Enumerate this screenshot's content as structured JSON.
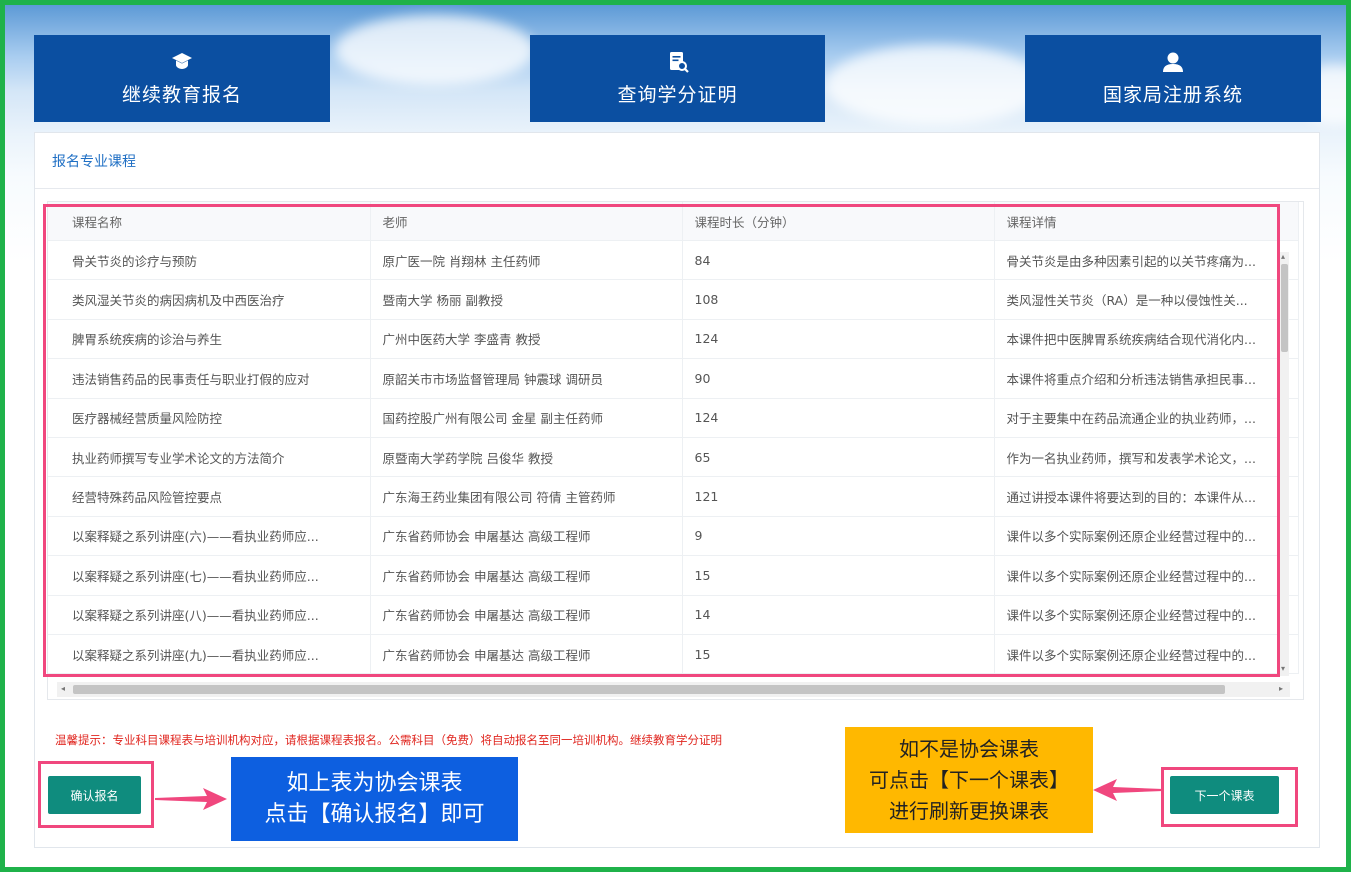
{
  "nav": [
    {
      "label": "继续教育报名",
      "icon": "graduation-cap-icon"
    },
    {
      "label": "查询学分证明",
      "icon": "document-search-icon"
    },
    {
      "label": "国家局注册系统",
      "icon": "user-icon"
    }
  ],
  "panel": {
    "title": "报名专业课程"
  },
  "table": {
    "columns": [
      "课程名称",
      "老师",
      "课程时长（分钟）",
      "课程详情"
    ],
    "rows": [
      [
        "骨关节炎的诊疗与预防",
        "原广医一院 肖翔林 主任药师",
        "84",
        "骨关节炎是由多种因素引起的以关节疼痛为..."
      ],
      [
        "类风湿关节炎的病因病机及中西医治疗",
        "暨南大学 杨丽 副教授",
        "108",
        "类风湿性关节炎（RA）是一种以侵蚀性关..."
      ],
      [
        "脾胃系统疾病的诊治与养生",
        "广州中医药大学 李盛青 教授",
        "124",
        "本课件把中医脾胃系统疾病结合现代消化内..."
      ],
      [
        "违法销售药品的民事责任与职业打假的应对",
        "原韶关市市场监督管理局 钟震球 调研员",
        "90",
        "本课件将重点介绍和分析违法销售承担民事..."
      ],
      [
        "医疗器械经营质量风险防控",
        "国药控股广州有限公司 金星 副主任药师",
        "124",
        "对于主要集中在药品流通企业的执业药师，..."
      ],
      [
        "执业药师撰写专业学术论文的方法简介",
        "原暨南大学药学院 吕俊华 教授",
        "65",
        "作为一名执业药师，撰写和发表学术论文，..."
      ],
      [
        "经营特殊药品风险管控要点",
        "广东海王药业集团有限公司 符倩 主管药师",
        "121",
        "通过讲授本课件将要达到的目的：本课件从..."
      ],
      [
        "以案释疑之系列讲座(六)——看执业药师应...",
        "广东省药师协会 申屠基达 高级工程师",
        "9",
        "课件以多个实际案例还原企业经营过程中的..."
      ],
      [
        "以案释疑之系列讲座(七)——看执业药师应...",
        "广东省药师协会 申屠基达 高级工程师",
        "15",
        "课件以多个实际案例还原企业经营过程中的..."
      ],
      [
        "以案释疑之系列讲座(八)——看执业药师应...",
        "广东省药师协会 申屠基达 高级工程师",
        "14",
        "课件以多个实际案例还原企业经营过程中的..."
      ],
      [
        "以案释疑之系列讲座(九)——看执业药师应...",
        "广东省药师协会 申屠基达 高级工程师",
        "15",
        "课件以多个实际案例还原企业经营过程中的..."
      ]
    ]
  },
  "hint": "温馨提示：专业科目课程表与培训机构对应，请根据课程表报名。公需科目（免费）将自动报名至同一培训机构。继续教育学分证明",
  "buttons": {
    "confirm": "确认报名",
    "next": "下一个课表"
  },
  "callouts": {
    "left": [
      "如上表为协会课表",
      "点击【确认报名】即可"
    ],
    "right": [
      "如不是协会课表",
      "可点击【下一个课表】",
      "进行刷新更换课表"
    ]
  },
  "colors": {
    "frame_green": "#1fb24a",
    "nav_blue": "#0b4fa1",
    "highlight_pink": "#f0477e",
    "button_teal": "#0f8c7e",
    "callout_blue": "#0d5fe0",
    "callout_yellow": "#ffb800",
    "hint_red": "#e0261f"
  }
}
